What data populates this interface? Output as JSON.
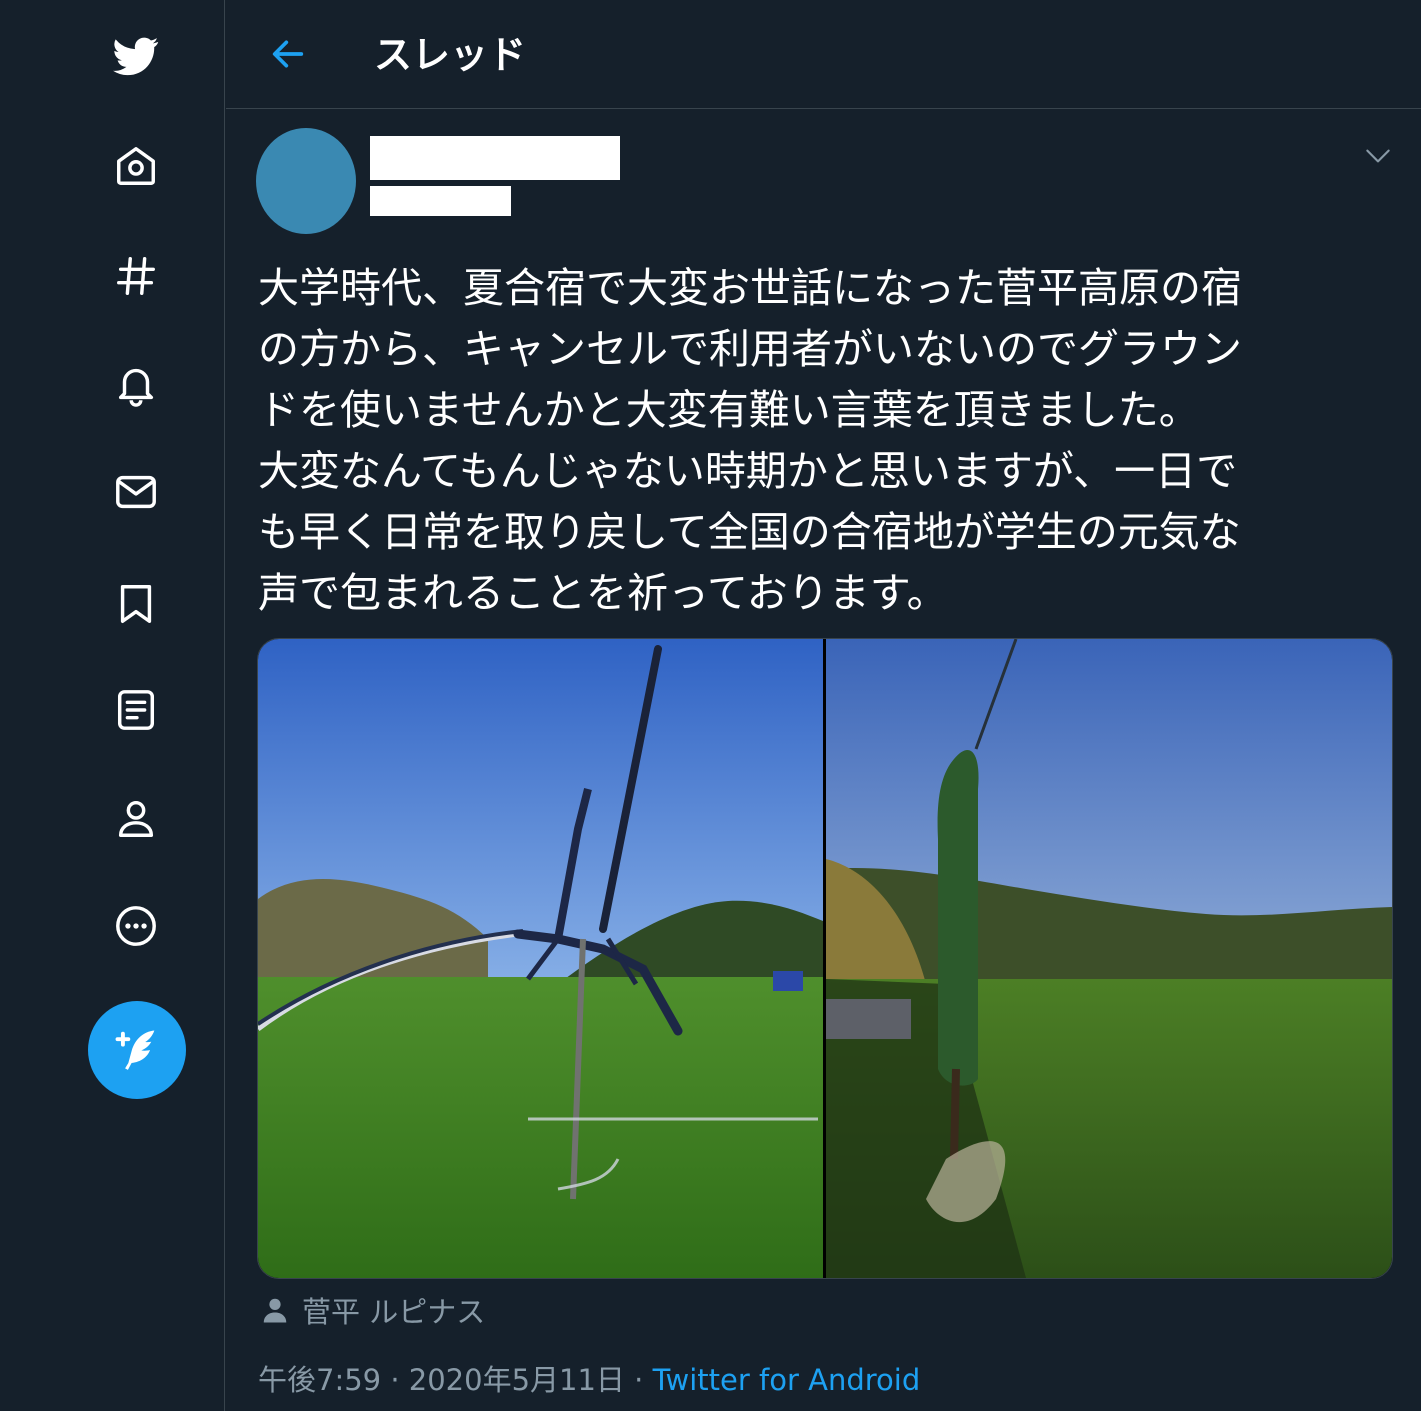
{
  "header": {
    "title": "スレッド",
    "back_icon": "arrow-left-icon"
  },
  "sidebar": {
    "items": [
      {
        "name": "twitter-logo-icon",
        "label": ""
      },
      {
        "name": "home-icon",
        "label": ""
      },
      {
        "name": "hashtag-icon",
        "label": ""
      },
      {
        "name": "bell-icon",
        "label": ""
      },
      {
        "name": "mail-icon",
        "label": ""
      },
      {
        "name": "bookmark-icon",
        "label": ""
      },
      {
        "name": "list-icon",
        "label": ""
      },
      {
        "name": "profile-icon",
        "label": ""
      },
      {
        "name": "more-icon",
        "label": ""
      }
    ],
    "compose_icon": "compose-tweet-icon"
  },
  "tweet": {
    "text": "大学時代、夏合宿で大変お世話になった菅平高原の宿\nの方から、キャンセルで利用者がいないのでグラウン\nドを使いませんかと大変有難い言葉を頂きました。\n大変なんてもんじゃない時期かと思いますが、一日で\nも早く日常を取り戻して全国の合宿地が学生の元気な\n声で包まれることを祈っております。",
    "location": "菅平 ルピナス",
    "time": "午後7:59",
    "separator": "·",
    "date": "2020年5月11日",
    "source": "Twitter for Android"
  },
  "colors": {
    "background": "#15202b",
    "border": "#38444d",
    "accent": "#1da1f2",
    "muted": "#8899a6",
    "avatar": "#3a89b2"
  }
}
